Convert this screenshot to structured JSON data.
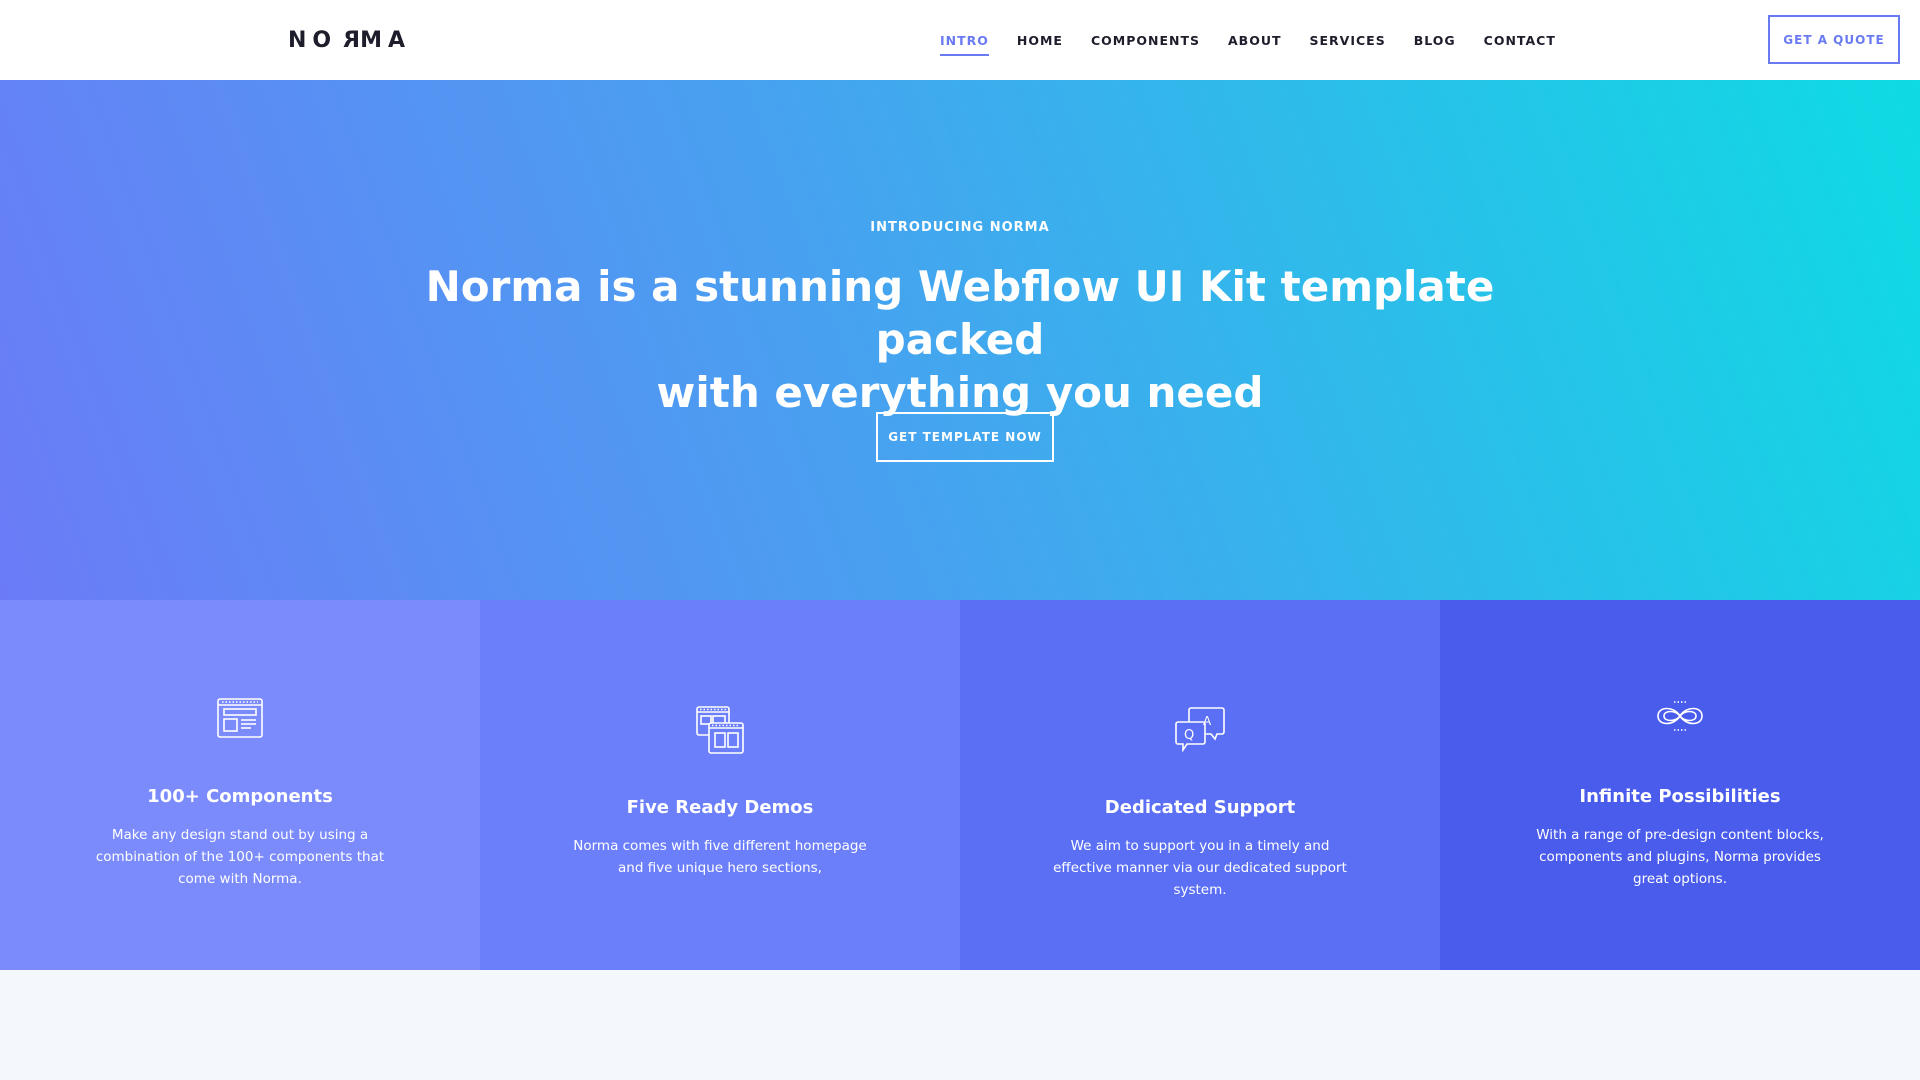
{
  "nav": {
    "logo": {
      "l1": "N",
      "l2": "O",
      "l3": "R",
      "l4": "MA"
    },
    "links": [
      "INTRO",
      "HOME",
      "COMPONENTS",
      "ABOUT",
      "SERVICES",
      "BLOG",
      "CONTACT"
    ],
    "active": "INTRO",
    "quote_label": "GET A QUOTE"
  },
  "hero": {
    "eyebrow": "INTRODUCING NORMA",
    "headline_line1": "Norma is a stunning Webflow UI Kit template packed",
    "headline_line2": "with everything you need",
    "cta_label": "GET TEMPLATE NOW"
  },
  "features": [
    {
      "icon": "browser-layout-icon",
      "title": "100+ Components",
      "description": "Make any design stand out by using a combination of the 100+ components that come with Norma.",
      "bg": "#7b8bfb"
    },
    {
      "icon": "windows-stack-icon",
      "title": "Five Ready Demos",
      "description": "Norma comes with five different homepage and five unique hero sections,",
      "bg": "#6c7ffb"
    },
    {
      "icon": "qa-chat-icon",
      "title": "Dedicated Support",
      "description": "We aim to support you in a timely and effective manner via our dedicated support system.",
      "bg": "#5b6ff5"
    },
    {
      "icon": "infinity-icon",
      "title": "Infinite Possibilities",
      "description": "With a range of pre-design content blocks, components and plugins, Norma provides great options.",
      "bg": "#4a5cec"
    }
  ],
  "colors": {
    "accent": "#6a7bf2",
    "hero_start": "#6b7bf7",
    "hero_end": "#0edbe3",
    "page_bg": "#f4f7fb"
  }
}
